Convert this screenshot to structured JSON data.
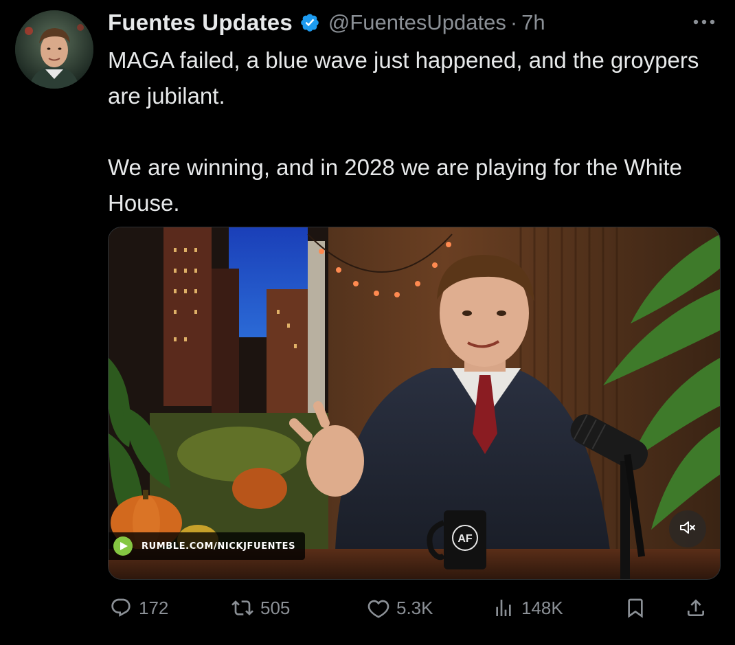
{
  "author": {
    "display_name": "Fuentes Updates",
    "handle": "@FuentesUpdates",
    "separator": "·",
    "timestamp": "7h",
    "verified_icon": "verified-badge-icon",
    "verified_color": "#1d9bf0"
  },
  "more_icon": "more-options-icon",
  "tweet": {
    "paragraph_1": "MAGA failed, a blue wave just happened, and the groypers are jubilant.",
    "paragraph_2": "We are winning, and in 2028 we are playing for the White House."
  },
  "media": {
    "watermark": "RUMBLE.COM/NICKJFUENTES",
    "watermark_icon": "rumble-logo-icon",
    "mug_logo": "AF",
    "mute_icon": "muted-speaker-icon"
  },
  "actions": {
    "replies": "172",
    "reposts": "505",
    "likes": "5.3K",
    "views": "148K",
    "reply_icon": "reply-icon",
    "repost_icon": "repost-icon",
    "like_icon": "heart-icon",
    "views_icon": "views-chart-icon",
    "bookmark_icon": "bookmark-icon",
    "share_icon": "share-icon"
  },
  "colors": {
    "background": "#000000",
    "text_primary": "#e7e9ea",
    "text_secondary": "#8b9096",
    "rumble_green": "#85c742"
  }
}
